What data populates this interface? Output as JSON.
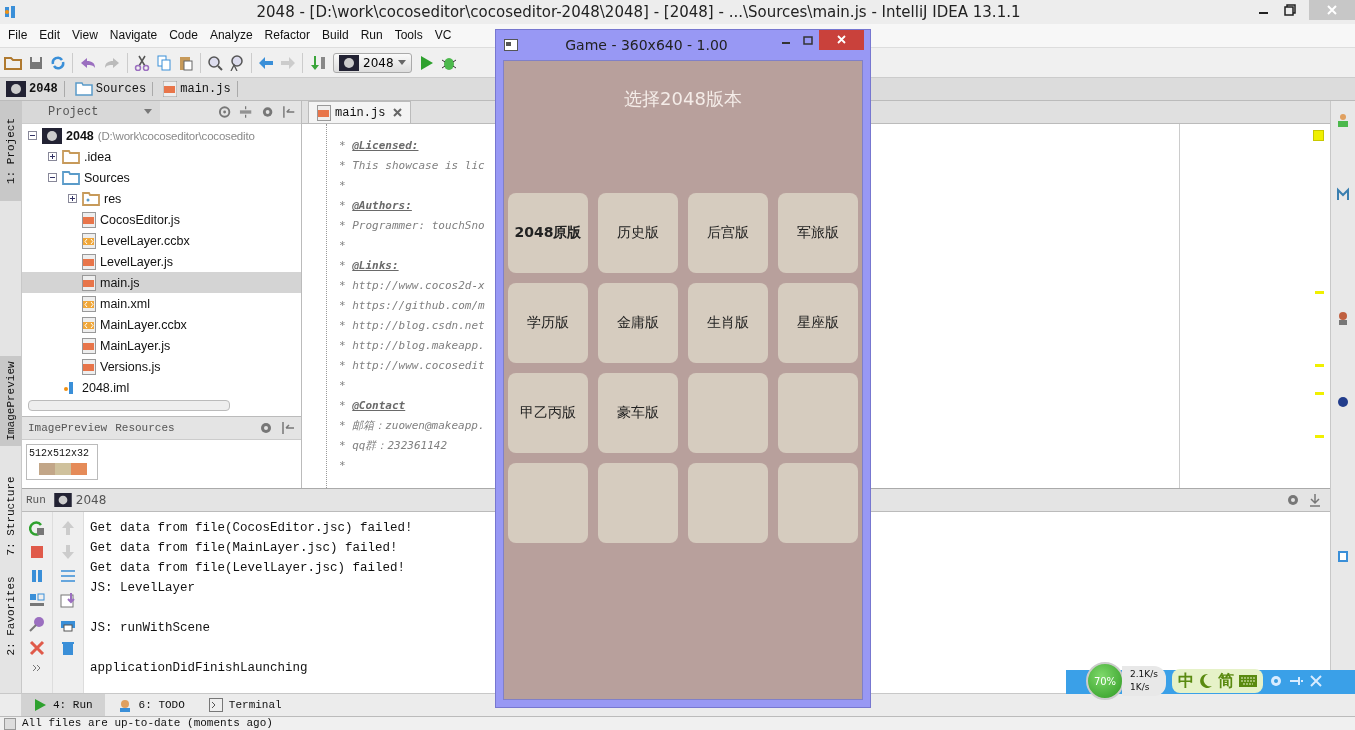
{
  "window": {
    "title": "2048 - [D:\\work\\cocoseditor\\cocoseditor-2048\\2048] - [2048] - ...\\Sources\\main.js - IntelliJ IDEA 13.1.1"
  },
  "menu": [
    "File",
    "Edit",
    "View",
    "Navigate",
    "Code",
    "Analyze",
    "Refactor",
    "Build",
    "Run",
    "Tools",
    "VC"
  ],
  "toolbar": {
    "run_config": "2048"
  },
  "breadcrumbs": [
    {
      "label": "2048",
      "kind": "module"
    },
    {
      "label": "Sources",
      "kind": "source-folder"
    },
    {
      "label": "main.js",
      "kind": "js"
    }
  ],
  "left_stripe": [
    {
      "label": "1: Project",
      "selected": true
    },
    {
      "label": "ImagePreview",
      "selected": true
    },
    {
      "label": "7: Structure",
      "selected": false
    },
    {
      "label": "2: Favorites",
      "selected": false
    }
  ],
  "project_panel": {
    "title": "Project",
    "tree": [
      {
        "name": "2048",
        "path": "(D:\\work\\cocoseditor\\cocosedito",
        "kind": "module",
        "expanded": true,
        "selected": false,
        "children": [
          {
            "name": ".idea",
            "kind": "folder",
            "expanded": false,
            "selected": false
          },
          {
            "name": "Sources",
            "kind": "source-folder",
            "expanded": true,
            "selected": false,
            "children": [
              {
                "name": "res",
                "kind": "resource-folder",
                "expanded": false,
                "selected": false
              },
              {
                "name": "CocosEditor.js",
                "kind": "js",
                "selected": false
              },
              {
                "name": "LevelLayer.ccbx",
                "kind": "ccbx",
                "selected": false
              },
              {
                "name": "LevelLayer.js",
                "kind": "js",
                "selected": false
              },
              {
                "name": "main.js",
                "kind": "js",
                "selected": true
              },
              {
                "name": "main.xml",
                "kind": "xml",
                "selected": false
              },
              {
                "name": "MainLayer.ccbx",
                "kind": "ccbx",
                "selected": false
              },
              {
                "name": "MainLayer.js",
                "kind": "js",
                "selected": false
              },
              {
                "name": "Versions.js",
                "kind": "js",
                "selected": false
              }
            ]
          },
          {
            "name": "2048.iml",
            "kind": "iml",
            "selected": false
          }
        ]
      }
    ]
  },
  "image_preview": {
    "tabs": [
      "ImagePreview",
      "Resources"
    ],
    "thumbnail_label": "512x512x32"
  },
  "editor": {
    "tabs": [
      {
        "label": "main.js",
        "selected": true
      }
    ],
    "lines": [
      "* **@Licensed:**",
      "* This showcase is lic",
      "*",
      "* **@Authors:**",
      "* Programmer: touchSno",
      "*",
      "* **@Links:**",
      "* http://www.cocos2d-x",
      "* https://github.com/m",
      "* http://blog.csdn.net",
      "* http://blog.makeapp.",
      "* http://www.cocosedit",
      "*",
      "* **@Contact**",
      "* 邮箱：zuowen@makeapp.",
      "* qq群：232361142",
      "*"
    ]
  },
  "run_panel": {
    "title": "Run",
    "config": "2048",
    "console": [
      {
        "text": "Get data from file(CocosEditor.jsc) failed!",
        "blank_after": false
      },
      {
        "text": "Get data from file(MainLayer.jsc) failed!",
        "blank_after": false
      },
      {
        "text": "Get data from file(LevelLayer.jsc) failed!",
        "blank_after": false
      },
      {
        "text": "JS: LevelLayer",
        "blank_after": true
      },
      {
        "text": "JS: runWithScene",
        "blank_after": true
      },
      {
        "text": "applicationDidFinishLaunching",
        "blank_after": false
      }
    ]
  },
  "bottom_tabs": [
    {
      "label": "4: Run",
      "kind": "run",
      "selected": true
    },
    {
      "label": "6: TODO",
      "kind": "todo",
      "selected": false
    },
    {
      "label": "Terminal",
      "kind": "terminal",
      "selected": false
    }
  ],
  "status_bar": {
    "message": "All files are up-to-date (moments ago)"
  },
  "game_window": {
    "title": "Game - 360x640 - 1.00",
    "heading": "选择2048版本",
    "tiles": [
      {
        "kind": "version",
        "label": "2048原版"
      },
      {
        "kind": "version",
        "label": "历史版"
      },
      {
        "kind": "version",
        "label": "后宫版"
      },
      {
        "kind": "version",
        "label": "军旅版"
      },
      {
        "kind": "version",
        "label": "学历版"
      },
      {
        "kind": "version",
        "label": "金庸版"
      },
      {
        "kind": "version",
        "label": "生肖版"
      },
      {
        "kind": "version",
        "label": "星座版"
      },
      {
        "kind": "version",
        "label": "甲乙丙版"
      },
      {
        "kind": "version",
        "label": "豪车版"
      },
      {
        "kind": "empty"
      },
      {
        "kind": "empty"
      },
      {
        "kind": "empty"
      },
      {
        "kind": "empty"
      },
      {
        "kind": "empty"
      },
      {
        "kind": "empty"
      }
    ]
  },
  "tray_widget": {
    "cpu": "70%",
    "upload": "2.1K/s",
    "download": "1K/s",
    "ime_mode": "中",
    "ime_script": "简"
  }
}
